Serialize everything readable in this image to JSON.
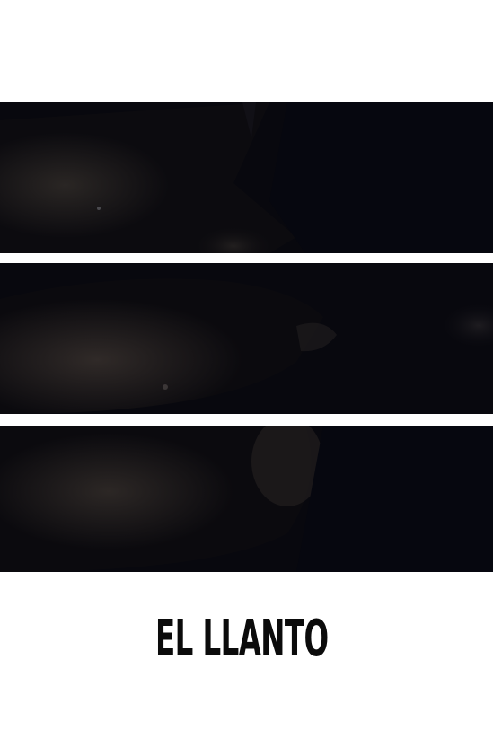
{
  "poster": {
    "title": "EL LLANTO",
    "background_color": "#ffffff",
    "title_color": "#0b0b0b",
    "strip_color": "#07070d",
    "image_strips": [
      {
        "name": "top-strip"
      },
      {
        "name": "middle-strip"
      },
      {
        "name": "bottom-strip"
      }
    ]
  }
}
